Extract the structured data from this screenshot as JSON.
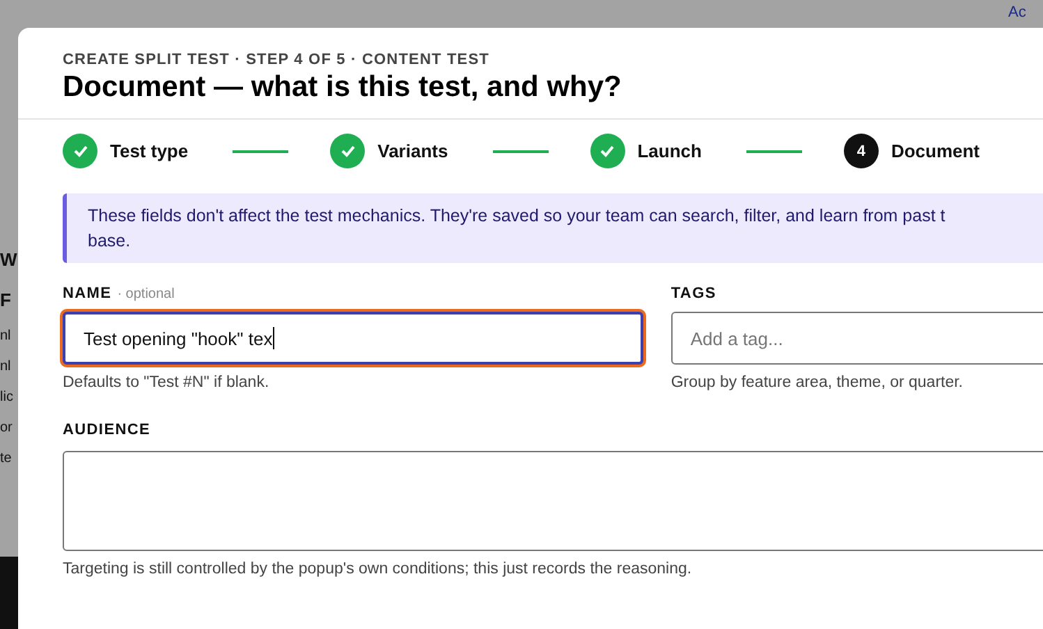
{
  "background": {
    "corner_link": "Ac",
    "fragments": [
      "W",
      "F",
      "nl",
      "nl",
      "lic",
      "or",
      "te"
    ]
  },
  "dialog": {
    "eyebrow": "CREATE SPLIT TEST · STEP 4 OF 5 · CONTENT TEST",
    "title": "Document — what is this test, and why?"
  },
  "steps": [
    {
      "label": "Test type",
      "kind": "done"
    },
    {
      "label": "Variants",
      "kind": "done"
    },
    {
      "label": "Launch",
      "kind": "done"
    },
    {
      "label": "Document",
      "kind": "current",
      "number": "4"
    }
  ],
  "notice": {
    "lines": [
      "These fields don't affect the test mechanics. They're saved so your team can search, filter, and learn from past t",
      "base."
    ]
  },
  "fields": {
    "name": {
      "label": "NAME",
      "note": "· optional",
      "value": "Test opening \"hook\" tex",
      "focused": true,
      "help": "Defaults to \"Test #N\" if blank."
    },
    "tags": {
      "label": "TAGS",
      "placeholder": "Add a tag...",
      "help": "Group by feature area, theme, or quarter."
    },
    "audience": {
      "label": "AUDIENCE",
      "help": "Targeting is still controlled by the popup's own conditions; this just records the reasoning."
    }
  }
}
